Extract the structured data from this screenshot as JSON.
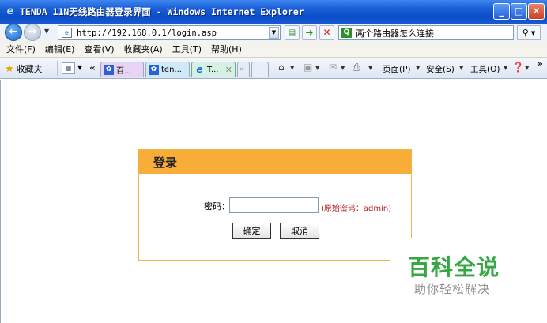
{
  "window": {
    "title": "TENDA 11N无线路由器登录界面 - Windows Internet Explorer",
    "minimize": "_",
    "maximize": "□",
    "close": "✕"
  },
  "address_bar": {
    "url": "http://192.168.0.1/login.asp",
    "search_text": "两个路由器怎么连接"
  },
  "menu": [
    "文件(F)",
    "编辑(E)",
    "查看(V)",
    "收藏夹(A)",
    "工具(T)",
    "帮助(H)"
  ],
  "favorites_bar": {
    "favorites_label": "收藏夹",
    "tabs": [
      {
        "label": "百..."
      },
      {
        "label": "ten..."
      },
      {
        "label": "T..."
      }
    ],
    "new_tab_label": "»",
    "commands": {
      "page": "页面(P)",
      "safety": "安全(S)",
      "tools": "工具(O)",
      "more": "»"
    }
  },
  "login": {
    "title": "登录",
    "password_label": "密码：",
    "password_value": "",
    "password_hint": "(原始密码：admin)",
    "ok_label": "确定",
    "cancel_label": "取消"
  },
  "watermark": {
    "main": "百科全说",
    "sub": "助你轻松解决"
  }
}
